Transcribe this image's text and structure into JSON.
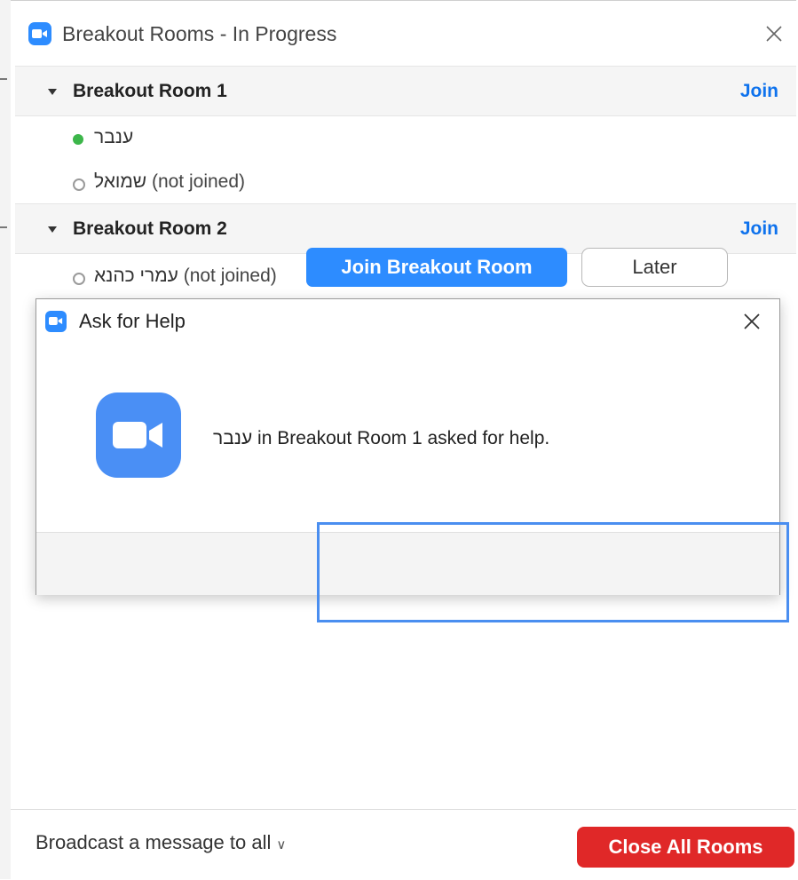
{
  "window": {
    "title": "Breakout Rooms - In Progress"
  },
  "rooms": [
    {
      "name": "Breakout Room 1",
      "join_label": "Join",
      "participants": [
        {
          "name": "ענבר",
          "status": "",
          "state": "joined"
        },
        {
          "name": "שמואל",
          "status": "(not joined)",
          "state": "not-joined"
        }
      ]
    },
    {
      "name": "Breakout Room 2",
      "join_label": "Join",
      "participants": [
        {
          "name": "עמרי כהנא",
          "status": "(not joined)",
          "state": "not-joined"
        }
      ]
    }
  ],
  "footer": {
    "broadcast_label": "Broadcast a message to all",
    "close_all_label": "Close All Rooms"
  },
  "dialog": {
    "title": "Ask for Help",
    "requester": "ענבר",
    "message": "in Breakout Room 1 asked for help.",
    "join_button": "Join Breakout Room",
    "later_button": "Later"
  },
  "colors": {
    "accent": "#2d8cff",
    "link": "#0e72ed",
    "danger": "#e02828",
    "online": "#3cb64a",
    "highlight": "#4a8ef0"
  },
  "icons": {
    "app": "zoom-camera-icon",
    "close": "close-icon",
    "caret": "caret-down-icon",
    "chevron": "chevron-down-icon"
  }
}
